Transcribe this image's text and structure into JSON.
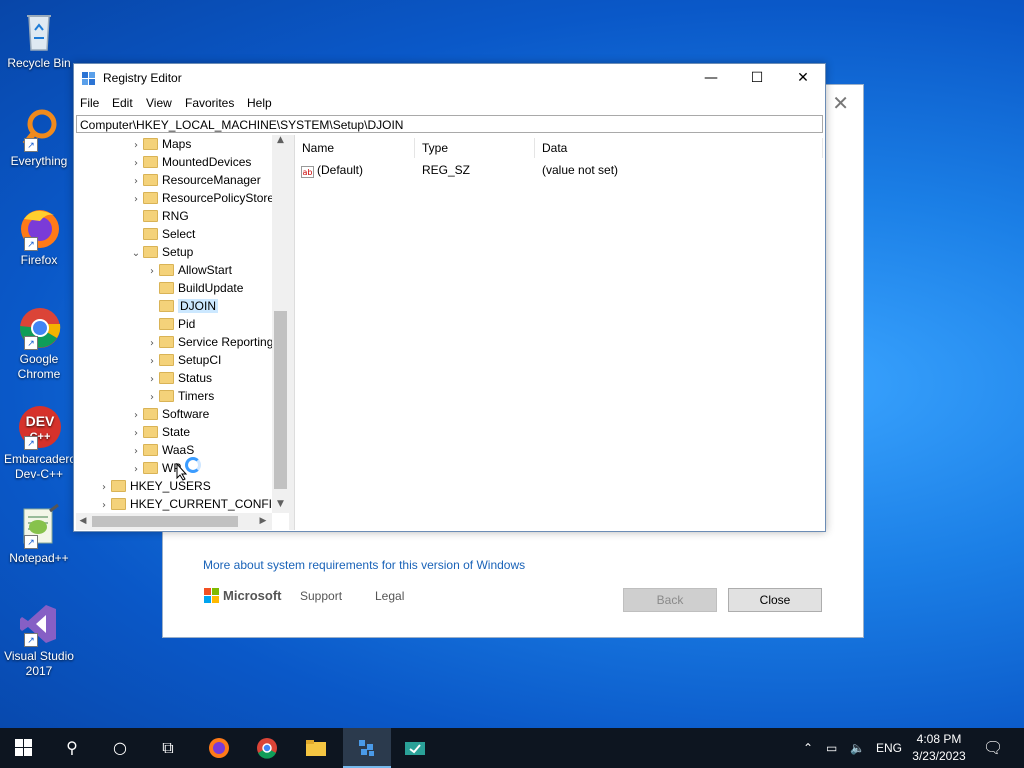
{
  "desktop": {
    "icons": [
      {
        "label": "Recycle Bin"
      },
      {
        "label": "Everything"
      },
      {
        "label": "Firefox"
      },
      {
        "label": "Google Chrome"
      },
      {
        "label": "Embarcadero Dev-C++"
      },
      {
        "label": "Notepad++"
      },
      {
        "label": "Visual Studio 2017"
      }
    ]
  },
  "setup_dialog": {
    "more_link": "More about system requirements for this version of Windows",
    "brand": "Microsoft",
    "support": "Support",
    "legal": "Legal",
    "back": "Back",
    "close": "Close"
  },
  "regedit": {
    "title": "Registry Editor",
    "menu": [
      "File",
      "Edit",
      "View",
      "Favorites",
      "Help"
    ],
    "address": "Computer\\HKEY_LOCAL_MACHINE\\SYSTEM\\Setup\\DJOIN",
    "tree": [
      {
        "label": "Maps",
        "arrow": "›"
      },
      {
        "label": "MountedDevices",
        "arrow": "›"
      },
      {
        "label": "ResourceManager",
        "arrow": "›"
      },
      {
        "label": "ResourcePolicyStore",
        "arrow": "›"
      },
      {
        "label": "RNG",
        "arrow": ""
      },
      {
        "label": "Select",
        "arrow": ""
      },
      {
        "label": "Setup",
        "arrow": "⌄"
      },
      {
        "label": "AllowStart",
        "arrow": "›"
      },
      {
        "label": "BuildUpdate",
        "arrow": ""
      },
      {
        "label": "DJOIN",
        "arrow": ""
      },
      {
        "label": "Pid",
        "arrow": ""
      },
      {
        "label": "Service Reporting",
        "arrow": "›"
      },
      {
        "label": "SetupCI",
        "arrow": "›"
      },
      {
        "label": "Status",
        "arrow": "›"
      },
      {
        "label": "Timers",
        "arrow": "›"
      },
      {
        "label": "Software",
        "arrow": "›"
      },
      {
        "label": "State",
        "arrow": "›"
      },
      {
        "label": "WaaS",
        "arrow": "›"
      },
      {
        "label": "WP",
        "arrow": "›"
      },
      {
        "label": "HKEY_USERS",
        "arrow": "›"
      },
      {
        "label": "HKEY_CURRENT_CONFIG",
        "arrow": "›"
      }
    ],
    "columns": [
      "Name",
      "Type",
      "Data"
    ],
    "values": [
      {
        "name": "(Default)",
        "type": "REG_SZ",
        "data": "(value not set)"
      }
    ]
  },
  "taskbar": {
    "language": "ENG",
    "time": "4:08 PM",
    "date": "3/23/2023"
  }
}
